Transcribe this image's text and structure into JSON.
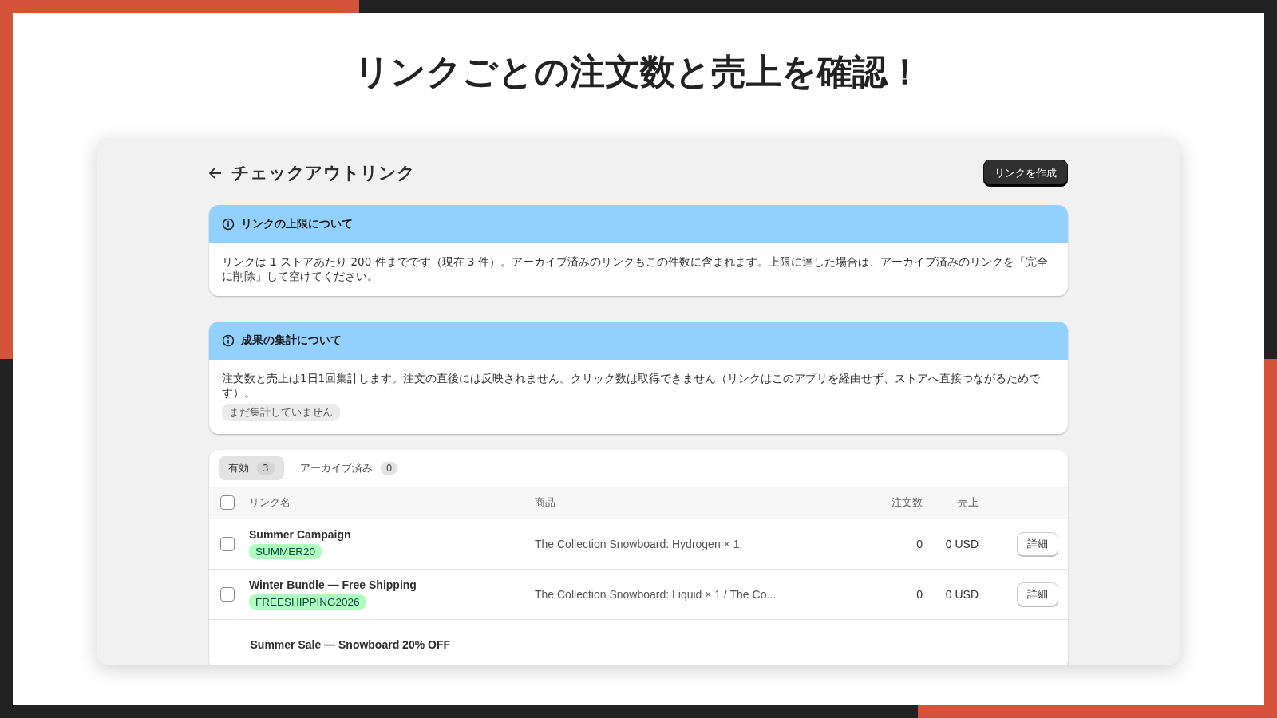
{
  "slide_title": "リンクごとの注文数と売上を確認！",
  "page": {
    "title": "チェックアウトリンク",
    "create_button": "リンクを作成"
  },
  "notices": [
    {
      "title": "リンクの上限について",
      "body": "リンクは 1 ストアあたり 200 件までです（現在 3 件）。アーカイブ済みのリンクもこの件数に含まれます。上限に達した場合は、アーカイブ済みのリンクを「完全に削除」して空けてください。"
    },
    {
      "title": "成果の集計について",
      "body": "注文数と売上は1日1回集計します。注文の直後には反映されません。クリック数は取得できません（リンクはこのアプリを経由せず、ストアへ直接つながるためです）。",
      "badge": "まだ集計していません"
    }
  ],
  "tabs": [
    {
      "label": "有効",
      "count": "3",
      "selected": true
    },
    {
      "label": "アーカイブ済み",
      "count": "0",
      "selected": false
    }
  ],
  "table": {
    "select_all_checked": false,
    "columns": [
      "リンク名",
      "商品",
      "注文数",
      "売上"
    ],
    "rows": [
      {
        "checked": false,
        "name": "Summer Campaign",
        "code": "SUMMER20",
        "product": "The Collection Snowboard: Hydrogen × 1",
        "orders": "0",
        "sales": "0 USD",
        "action": "詳細"
      },
      {
        "checked": false,
        "name": "Winter Bundle — Free Shipping",
        "code": "FREESHIPPING2026",
        "product": "The Collection Snowboard: Liquid × 1 / The Co...",
        "orders": "0",
        "sales": "0 USD",
        "action": "詳細"
      },
      {
        "name": "Summer Sale — Snowboard 20% OFF"
      }
    ]
  }
}
